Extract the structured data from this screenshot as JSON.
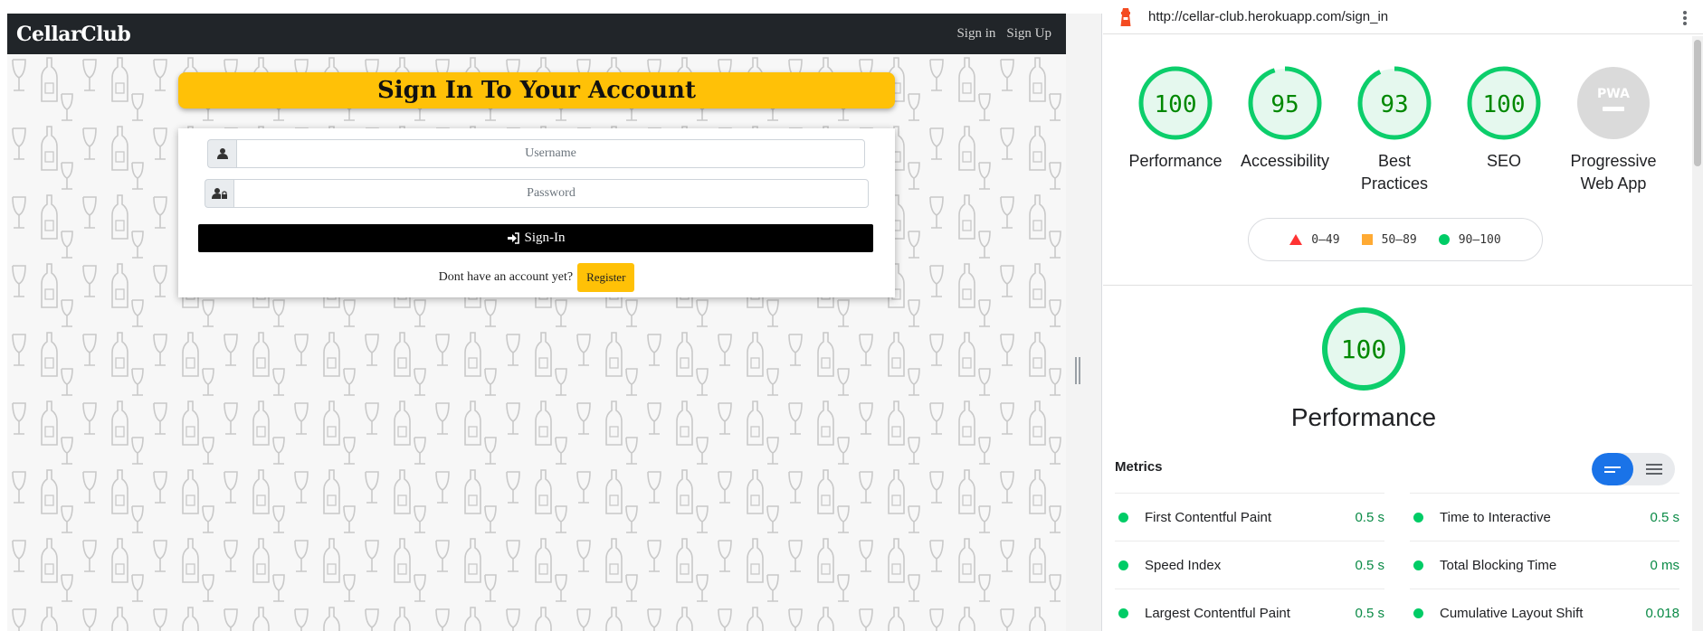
{
  "site": {
    "brand": "CellarClub",
    "nav": [
      "Sign in",
      "Sign Up"
    ],
    "heading": "Sign In To Your Account",
    "username_placeholder": "Username",
    "password_placeholder": "Password",
    "signin_label": "Sign-In",
    "register_prompt": "Dont have an account yet?",
    "register_label": "Register",
    "colors": {
      "accent": "#ffc107",
      "navbar": "#212529"
    }
  },
  "lighthouse": {
    "url": "http://cellar-club.herokuapp.com/sign_in",
    "scores": [
      {
        "label": "Performance",
        "score": "100",
        "value": 100
      },
      {
        "label": "Accessibility",
        "score": "95",
        "value": 95
      },
      {
        "label": "Best Practices",
        "score": "93",
        "value": 93
      },
      {
        "label": "SEO",
        "score": "100",
        "value": 100
      },
      {
        "label": "Progressive Web App",
        "score": "PWA",
        "value": null
      }
    ],
    "legend": [
      "0–49",
      "50–89",
      "90–100"
    ],
    "main_score": "100",
    "main_label": "Performance",
    "metrics_title": "Metrics",
    "metrics": [
      {
        "name": "First Contentful Paint",
        "value": "0.5 s"
      },
      {
        "name": "Speed Index",
        "value": "0.5 s"
      },
      {
        "name": "Largest Contentful Paint",
        "value": "0.5 s"
      },
      {
        "name": "Time to Interactive",
        "value": "0.5 s"
      },
      {
        "name": "Total Blocking Time",
        "value": "0 ms"
      },
      {
        "name": "Cumulative Layout Shift",
        "value": "0.018"
      }
    ],
    "colors": {
      "pass": "#0cce6b",
      "pass_text": "#0a8a46",
      "average": "#ffa400",
      "fail": "#ff3333"
    }
  }
}
